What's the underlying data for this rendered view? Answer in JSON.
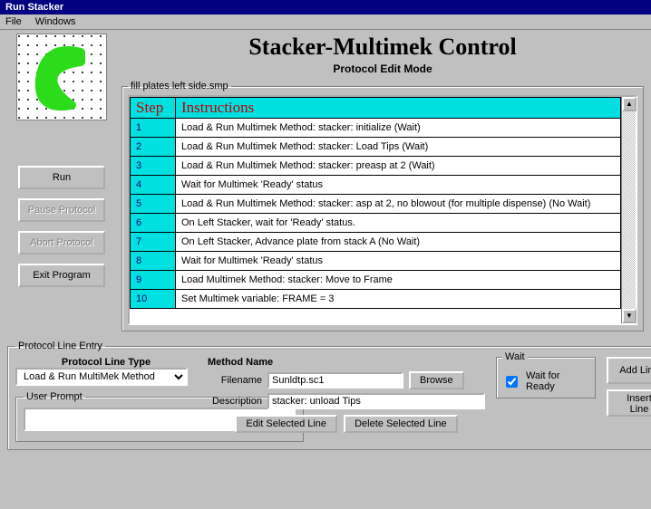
{
  "window": {
    "title": "Run Stacker"
  },
  "menu": {
    "file": "File",
    "windows": "Windows"
  },
  "heading": "Stacker-Multimek Control",
  "subheading": "Protocol Edit Mode",
  "buttons": {
    "run": "Run",
    "pause": "Pause Protocol",
    "abort": "Abort Protocol",
    "exit": "Exit Program",
    "browse": "Browse",
    "addline": "Add Line",
    "insertline": "Insert Line",
    "editsel": "Edit Selected Line",
    "delsel": "Delete Selected Line"
  },
  "protocol": {
    "filename_legend": "fill plates left side.smp",
    "col_step": "Step",
    "col_instr": "Instructions",
    "rows": [
      {
        "step": "1",
        "instr": "Load & Run Multimek Method: stacker: initialize (Wait)"
      },
      {
        "step": "2",
        "instr": "Load & Run Multimek Method: stacker: Load Tips (Wait)"
      },
      {
        "step": "3",
        "instr": "Load & Run Multimek Method: stacker: preasp at 2 (Wait)"
      },
      {
        "step": "4",
        "instr": "Wait for Multimek 'Ready' status"
      },
      {
        "step": "5",
        "instr": "Load & Run Multimek Method: stacker: asp at 2, no blowout (for multiple dispense) (No Wait)"
      },
      {
        "step": "6",
        "instr": "On Left Stacker, wait for 'Ready' status."
      },
      {
        "step": "7",
        "instr": "On Left Stacker, Advance plate from stack A (No Wait)"
      },
      {
        "step": "8",
        "instr": "Wait for Multimek 'Ready' status"
      },
      {
        "step": "9",
        "instr": "Load Multimek Method: stacker: Move to Frame"
      },
      {
        "step": "10",
        "instr": "Set Multimek variable: FRAME = 3"
      }
    ]
  },
  "entry": {
    "legend": "Protocol Line Entry",
    "linetype_label": "Protocol Line Type",
    "linetype_value": "Load & Run MultiMek Method",
    "methodname_label": "Method Name",
    "filename_label": "Filename",
    "filename_value": "Sunldtp.sc1",
    "desc_label": "Description",
    "desc_value": "stacker: unload Tips",
    "wait_legend": "Wait",
    "wait_label": "Wait for Ready",
    "userprompt_legend": "User Prompt",
    "userprompt_value": ""
  }
}
